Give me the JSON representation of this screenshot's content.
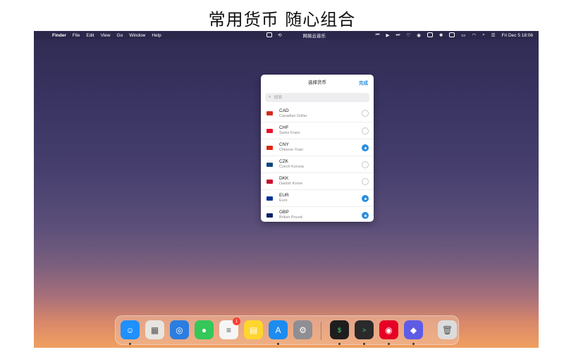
{
  "headline": "常用货币 随心组合",
  "menubar": {
    "apple_glyph": "",
    "app_name": "Finder",
    "menus": [
      "File",
      "Edit",
      "View",
      "Go",
      "Window",
      "Help"
    ],
    "status_app_title": "网易云音乐",
    "clock": "Fri Dec 5  18:06"
  },
  "popover": {
    "title": "选择货币",
    "done_label": "完成",
    "search_placeholder": "搜索",
    "currencies": [
      {
        "code": "CAD",
        "name": "Canadian Dollar",
        "selected": false,
        "flag_color": "#d52b1e"
      },
      {
        "code": "CHF",
        "name": "Swiss Franc",
        "selected": false,
        "flag_color": "#e8112d"
      },
      {
        "code": "CNY",
        "name": "Chinese Yuan",
        "selected": true,
        "flag_color": "#de2910"
      },
      {
        "code": "CZK",
        "name": "Czech Koruna",
        "selected": false,
        "flag_color": "#11457e"
      },
      {
        "code": "DKK",
        "name": "Danish Krone",
        "selected": false,
        "flag_color": "#c8102e"
      },
      {
        "code": "EUR",
        "name": "Euro",
        "selected": true,
        "flag_color": "#003399"
      },
      {
        "code": "GBP",
        "name": "British Pound",
        "selected": true,
        "flag_color": "#012169"
      }
    ]
  },
  "dock": {
    "badge_count": "1",
    "apps": [
      {
        "name": "finder-icon",
        "color": "#1e90ff"
      },
      {
        "name": "launchpad-icon",
        "color": "#e8e4e0"
      },
      {
        "name": "safari-icon",
        "color": "#2a7de1"
      },
      {
        "name": "messages-icon",
        "color": "#34c759"
      },
      {
        "name": "reminders-icon",
        "color": "#f5f5f5"
      },
      {
        "name": "notes-icon",
        "color": "#ffd52e"
      },
      {
        "name": "app-store-icon",
        "color": "#1c8cf0"
      },
      {
        "name": "system-settings-icon",
        "color": "#8e8e93"
      },
      {
        "name": "terminal-icon",
        "color": "#1e1e1e"
      },
      {
        "name": "console-icon",
        "color": "#2a2a2a"
      },
      {
        "name": "netease-music-icon",
        "color": "#e60026"
      },
      {
        "name": "shortcuts-icon",
        "color": "#5e5ce6"
      },
      {
        "name": "trash-icon",
        "color": "#dcdcdc"
      }
    ]
  }
}
